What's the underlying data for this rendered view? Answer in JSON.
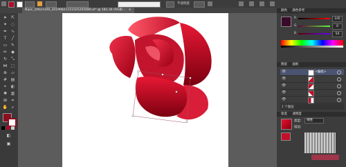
{
  "control_bar": {
    "fill_label": "",
    "stroke_label": "",
    "style_label": "",
    "opacity_label": "不透明度",
    "fill_color": "#b00a2a",
    "stroke_color": "#ffffff"
  },
  "document": {
    "tab_label": "Nipic_10623100_20190821151025205080.ai* @ 181.36 (RGB/...",
    "close_icon": "close-icon"
  },
  "tools": {
    "fill_color": "#8a0e1e",
    "stroke_color": "#ffffff",
    "icons": [
      "selection-icon",
      "direct-selection-icon",
      "magic-wand-icon",
      "lasso-icon",
      "pen-icon",
      "curvature-icon",
      "type-icon",
      "line-icon",
      "rectangle-icon",
      "paintbrush-icon",
      "pencil-icon",
      "eraser-icon",
      "rotate-icon",
      "scale-icon",
      "width-icon",
      "free-transform-icon",
      "shape-builder-icon",
      "perspective-icon",
      "mesh-icon",
      "gradient-icon",
      "eyedropper-icon",
      "blend-icon",
      "symbol-sprayer-icon",
      "column-graph-icon",
      "artboard-icon",
      "slice-icon",
      "hand-icon",
      "zoom-icon"
    ]
  },
  "color_panel": {
    "tabs": [
      "颜色",
      "颜色参考"
    ],
    "swatch_color": "#3a0a2a",
    "r_label": "R",
    "r_value": "105",
    "g_label": "G",
    "g_value": "0",
    "b_label": "B",
    "b_value": "54"
  },
  "layers_panel": {
    "tabs": [
      "图层",
      "画板"
    ],
    "layer_name": "<编组>",
    "footer_label": "1 个图层"
  },
  "gradient_panel": {
    "tabs": [
      "渐变",
      "透明度"
    ],
    "type_label": "类型:",
    "type_value": "线性",
    "stroke_label": "描边:",
    "start_color": "#e8102f",
    "end_color": "#8a0010"
  }
}
